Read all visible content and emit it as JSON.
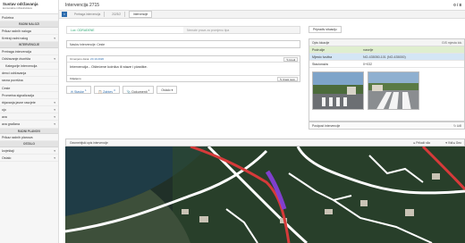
{
  "brand": {
    "title": "Sustav održavanja",
    "subtitle": "komunalne infrastrukture"
  },
  "sidebar": {
    "items": [
      {
        "label": "Početna",
        "kind": "item"
      },
      {
        "label": "RADNI NALOZI",
        "kind": "header"
      },
      {
        "label": "Prikaz radnih naloga",
        "kind": "item"
      },
      {
        "label": "Kreiraj radni nalog",
        "kind": "item",
        "chevron": "▾"
      },
      {
        "label": "INTERVENCIJE",
        "kind": "header"
      },
      {
        "label": "Pretraga intervencija",
        "kind": "item"
      },
      {
        "label": "Održavanje dvorišta",
        "kind": "item",
        "chevron": "▾"
      },
      {
        "label": "Kategorije intervencija",
        "kind": "sub"
      },
      {
        "label": "denci održavanja",
        "kind": "item"
      },
      {
        "label": "ravna površina",
        "kind": "item"
      },
      {
        "label": "Ceste",
        "kind": "item"
      },
      {
        "label": "Prometna signalizacija",
        "kind": "item"
      },
      {
        "label": "rbjavanja javne rasvjete",
        "kind": "item",
        "chevron": "▾"
      },
      {
        "label": "ojo",
        "kind": "item",
        "chevron": "▾"
      },
      {
        "label": "ava",
        "kind": "item",
        "chevron": "▾"
      },
      {
        "label": "ava građana",
        "kind": "item",
        "chevron": "▾"
      },
      {
        "label": "RADNI PLANOVI",
        "kind": "header"
      },
      {
        "label": "Prikaz radnih planova",
        "kind": "item"
      },
      {
        "label": "OSTALO",
        "kind": "header"
      },
      {
        "label": "Izvještaji",
        "kind": "item",
        "chevron": "▾"
      },
      {
        "label": "Ostalo",
        "kind": "item",
        "chevron": "▾"
      }
    ]
  },
  "topbar": {
    "title": "Intervencija 2715",
    "counter": "0 / 8"
  },
  "breadcrumb": {
    "home_icon": "home-icon",
    "items": [
      "Pretraga intervencija",
      "2/2/3/2",
      "Intervencije"
    ]
  },
  "tabs": [
    {
      "label": "Lux: ODRAĐENE",
      "active": true
    },
    {
      "label": "Nemate prava za promjenu tipa",
      "active": false
    }
  ],
  "form": {
    "field1": "Naslov intervencije: Ceste",
    "detail_meta_prefix": "Izmenjeno dana:",
    "detail_meta_date": "20.10.2020",
    "edit_button": "✎ Uredi",
    "detail_text": "Intervencija - Oštećene kolnika ili staze i plastike.",
    "detail_footer": "Odjeljeno",
    "detail_footer_button": "✎ Unesi novo"
  },
  "actions": [
    {
      "label": "Stavke",
      "count": "1",
      "icon": "✉"
    },
    {
      "label": "Zahtev",
      "count": "3",
      "icon": "📋"
    },
    {
      "label": "Dokumenti",
      "count": "1",
      "icon": "📎"
    },
    {
      "label": "Ostalo ▾",
      "count": "",
      "icon": ""
    }
  ],
  "right": {
    "print_button": "Pripradiv situaciju",
    "location_title": "Opis lokacije",
    "location_right": "GIS mjesta lok.",
    "rows": [
      {
        "k": "Područje",
        "v": "naselje",
        "style": "green"
      },
      {
        "k": "Mjesto Ivožba",
        "v": "NO-435050-101 (NO-435000)",
        "style": "blue"
      },
      {
        "k": "Stacionaža",
        "v": "0+032",
        "style": "plain"
      }
    ],
    "post_title": "Postpost intervencije",
    "post_right": "↻ Uđi"
  },
  "map": {
    "title": "Geometrijski opis intervencije",
    "zoom_label": "▸ Prikaži sila",
    "tools_label": "▾ Vidi  ▸ Geo"
  }
}
